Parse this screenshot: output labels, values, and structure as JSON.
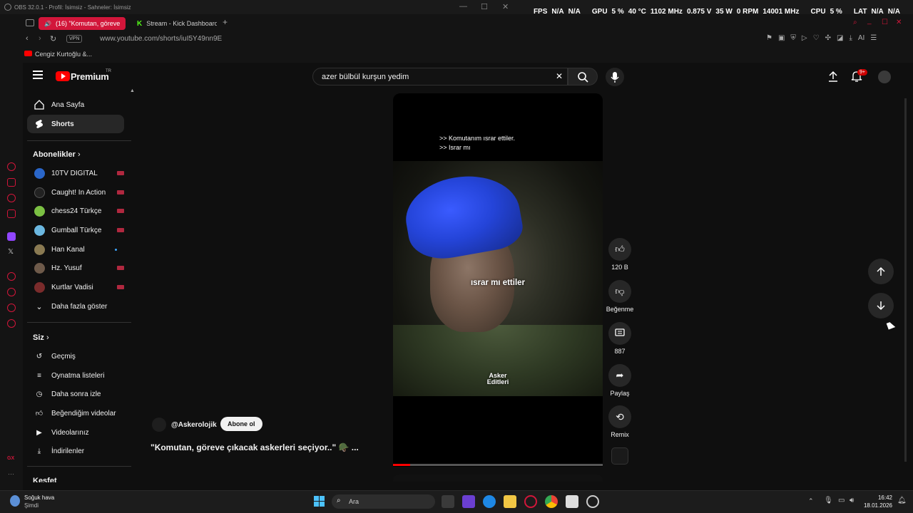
{
  "obs": {
    "title": "OBS 32.0.1 - Profil: İsimsiz - Sahneler: İsimsiz"
  },
  "stats": {
    "fps_label": "FPS",
    "fps1": "N/A",
    "fps2": "N/A",
    "gpu_label": "GPU",
    "gpu_pct": "5 %",
    "gpu_temp": "40 °C",
    "gpu_clock": "1102 MHz",
    "gpu_volt": "0.875 V",
    "gpu_watt": "35 W",
    "gpu_rpm": "0 RPM",
    "gpu_mem": "14001 MHz",
    "cpu_label": "CPU",
    "cpu_pct": "5 %",
    "lat_label": "LAT",
    "lat1": "N/A",
    "lat2": "N/A"
  },
  "browser": {
    "tabs": [
      {
        "label": "(16) \"Komutan, göreve"
      },
      {
        "label": "Stream - Kick Dashboard"
      }
    ],
    "vpn": "VPN",
    "url": "www.youtube.com/shorts/iuI5Y49nn9E",
    "bookmark": "Cengiz Kurtoğlu &...",
    "ai": "AI"
  },
  "yt": {
    "logo": "Premium",
    "logo_sup": "TR",
    "search_query": "azer bülbül kurşun yedim",
    "notif_badge": "9+",
    "nav": [
      {
        "label": "Ana Sayfa"
      },
      {
        "label": "Shorts"
      }
    ],
    "subs_title": "Abonelikler",
    "subs": [
      {
        "label": "10TV DIGITAL"
      },
      {
        "label": "Caught! In Action"
      },
      {
        "label": "chess24 Türkçe"
      },
      {
        "label": "Gumball Türkçe"
      },
      {
        "label": "Han Kanal"
      },
      {
        "label": "Hz. Yusuf"
      },
      {
        "label": "Kurtlar Vadisi"
      }
    ],
    "show_more": "Daha fazla göster",
    "you_title": "Siz",
    "you": [
      {
        "label": "Geçmiş"
      },
      {
        "label": "Oynatma listeleri"
      },
      {
        "label": "Daha sonra izle"
      },
      {
        "label": "Beğendiğim videolar"
      },
      {
        "label": "Videolarınız"
      },
      {
        "label": "İndirilenler"
      }
    ],
    "explore": "Keşfet",
    "video": {
      "sub1": ">> Komutanım ısrar ettiler.",
      "sub2": ">> Israr mı",
      "caption": "ısrar mı ettiler",
      "watermark1": "Asker",
      "watermark2": "Editleri",
      "progress": 0.08
    },
    "channel": "@Askerolojik",
    "subscribe": "Abone ol",
    "title": "\"Komutan, göreve çıkacak askerleri seçiyor..\" 🪖 ...",
    "actions": {
      "likes": "120 B",
      "dislike": "Beğenme",
      "comments": "887",
      "share": "Paylaş",
      "remix": "Remix"
    }
  },
  "taskbar": {
    "weather1": "Soğuk hava",
    "weather2": "Şimdi",
    "search": "Ara",
    "time": "16:42",
    "date": "18.01.2026"
  }
}
